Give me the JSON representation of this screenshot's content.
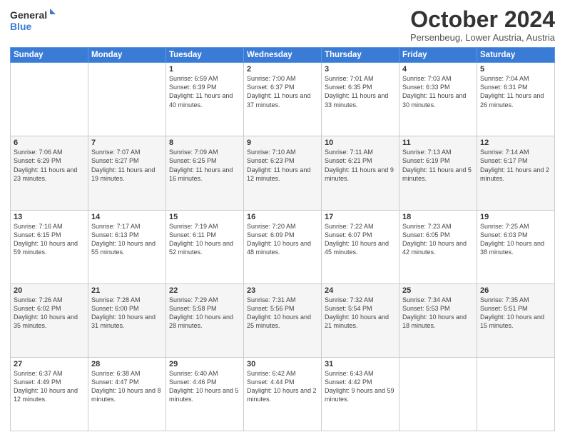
{
  "header": {
    "logo_general": "General",
    "logo_blue": "Blue",
    "title": "October 2024",
    "location": "Persenbeug, Lower Austria, Austria"
  },
  "weekdays": [
    "Sunday",
    "Monday",
    "Tuesday",
    "Wednesday",
    "Thursday",
    "Friday",
    "Saturday"
  ],
  "weeks": [
    [
      {
        "day": "",
        "info": ""
      },
      {
        "day": "",
        "info": ""
      },
      {
        "day": "1",
        "info": "Sunrise: 6:59 AM\nSunset: 6:39 PM\nDaylight: 11 hours and 40 minutes."
      },
      {
        "day": "2",
        "info": "Sunrise: 7:00 AM\nSunset: 6:37 PM\nDaylight: 11 hours and 37 minutes."
      },
      {
        "day": "3",
        "info": "Sunrise: 7:01 AM\nSunset: 6:35 PM\nDaylight: 11 hours and 33 minutes."
      },
      {
        "day": "4",
        "info": "Sunrise: 7:03 AM\nSunset: 6:33 PM\nDaylight: 11 hours and 30 minutes."
      },
      {
        "day": "5",
        "info": "Sunrise: 7:04 AM\nSunset: 6:31 PM\nDaylight: 11 hours and 26 minutes."
      }
    ],
    [
      {
        "day": "6",
        "info": "Sunrise: 7:06 AM\nSunset: 6:29 PM\nDaylight: 11 hours and 23 minutes."
      },
      {
        "day": "7",
        "info": "Sunrise: 7:07 AM\nSunset: 6:27 PM\nDaylight: 11 hours and 19 minutes."
      },
      {
        "day": "8",
        "info": "Sunrise: 7:09 AM\nSunset: 6:25 PM\nDaylight: 11 hours and 16 minutes."
      },
      {
        "day": "9",
        "info": "Sunrise: 7:10 AM\nSunset: 6:23 PM\nDaylight: 11 hours and 12 minutes."
      },
      {
        "day": "10",
        "info": "Sunrise: 7:11 AM\nSunset: 6:21 PM\nDaylight: 11 hours and 9 minutes."
      },
      {
        "day": "11",
        "info": "Sunrise: 7:13 AM\nSunset: 6:19 PM\nDaylight: 11 hours and 5 minutes."
      },
      {
        "day": "12",
        "info": "Sunrise: 7:14 AM\nSunset: 6:17 PM\nDaylight: 11 hours and 2 minutes."
      }
    ],
    [
      {
        "day": "13",
        "info": "Sunrise: 7:16 AM\nSunset: 6:15 PM\nDaylight: 10 hours and 59 minutes."
      },
      {
        "day": "14",
        "info": "Sunrise: 7:17 AM\nSunset: 6:13 PM\nDaylight: 10 hours and 55 minutes."
      },
      {
        "day": "15",
        "info": "Sunrise: 7:19 AM\nSunset: 6:11 PM\nDaylight: 10 hours and 52 minutes."
      },
      {
        "day": "16",
        "info": "Sunrise: 7:20 AM\nSunset: 6:09 PM\nDaylight: 10 hours and 48 minutes."
      },
      {
        "day": "17",
        "info": "Sunrise: 7:22 AM\nSunset: 6:07 PM\nDaylight: 10 hours and 45 minutes."
      },
      {
        "day": "18",
        "info": "Sunrise: 7:23 AM\nSunset: 6:05 PM\nDaylight: 10 hours and 42 minutes."
      },
      {
        "day": "19",
        "info": "Sunrise: 7:25 AM\nSunset: 6:03 PM\nDaylight: 10 hours and 38 minutes."
      }
    ],
    [
      {
        "day": "20",
        "info": "Sunrise: 7:26 AM\nSunset: 6:02 PM\nDaylight: 10 hours and 35 minutes."
      },
      {
        "day": "21",
        "info": "Sunrise: 7:28 AM\nSunset: 6:00 PM\nDaylight: 10 hours and 31 minutes."
      },
      {
        "day": "22",
        "info": "Sunrise: 7:29 AM\nSunset: 5:58 PM\nDaylight: 10 hours and 28 minutes."
      },
      {
        "day": "23",
        "info": "Sunrise: 7:31 AM\nSunset: 5:56 PM\nDaylight: 10 hours and 25 minutes."
      },
      {
        "day": "24",
        "info": "Sunrise: 7:32 AM\nSunset: 5:54 PM\nDaylight: 10 hours and 21 minutes."
      },
      {
        "day": "25",
        "info": "Sunrise: 7:34 AM\nSunset: 5:53 PM\nDaylight: 10 hours and 18 minutes."
      },
      {
        "day": "26",
        "info": "Sunrise: 7:35 AM\nSunset: 5:51 PM\nDaylight: 10 hours and 15 minutes."
      }
    ],
    [
      {
        "day": "27",
        "info": "Sunrise: 6:37 AM\nSunset: 4:49 PM\nDaylight: 10 hours and 12 minutes."
      },
      {
        "day": "28",
        "info": "Sunrise: 6:38 AM\nSunset: 4:47 PM\nDaylight: 10 hours and 8 minutes."
      },
      {
        "day": "29",
        "info": "Sunrise: 6:40 AM\nSunset: 4:46 PM\nDaylight: 10 hours and 5 minutes."
      },
      {
        "day": "30",
        "info": "Sunrise: 6:42 AM\nSunset: 4:44 PM\nDaylight: 10 hours and 2 minutes."
      },
      {
        "day": "31",
        "info": "Sunrise: 6:43 AM\nSunset: 4:42 PM\nDaylight: 9 hours and 59 minutes."
      },
      {
        "day": "",
        "info": ""
      },
      {
        "day": "",
        "info": ""
      }
    ]
  ]
}
